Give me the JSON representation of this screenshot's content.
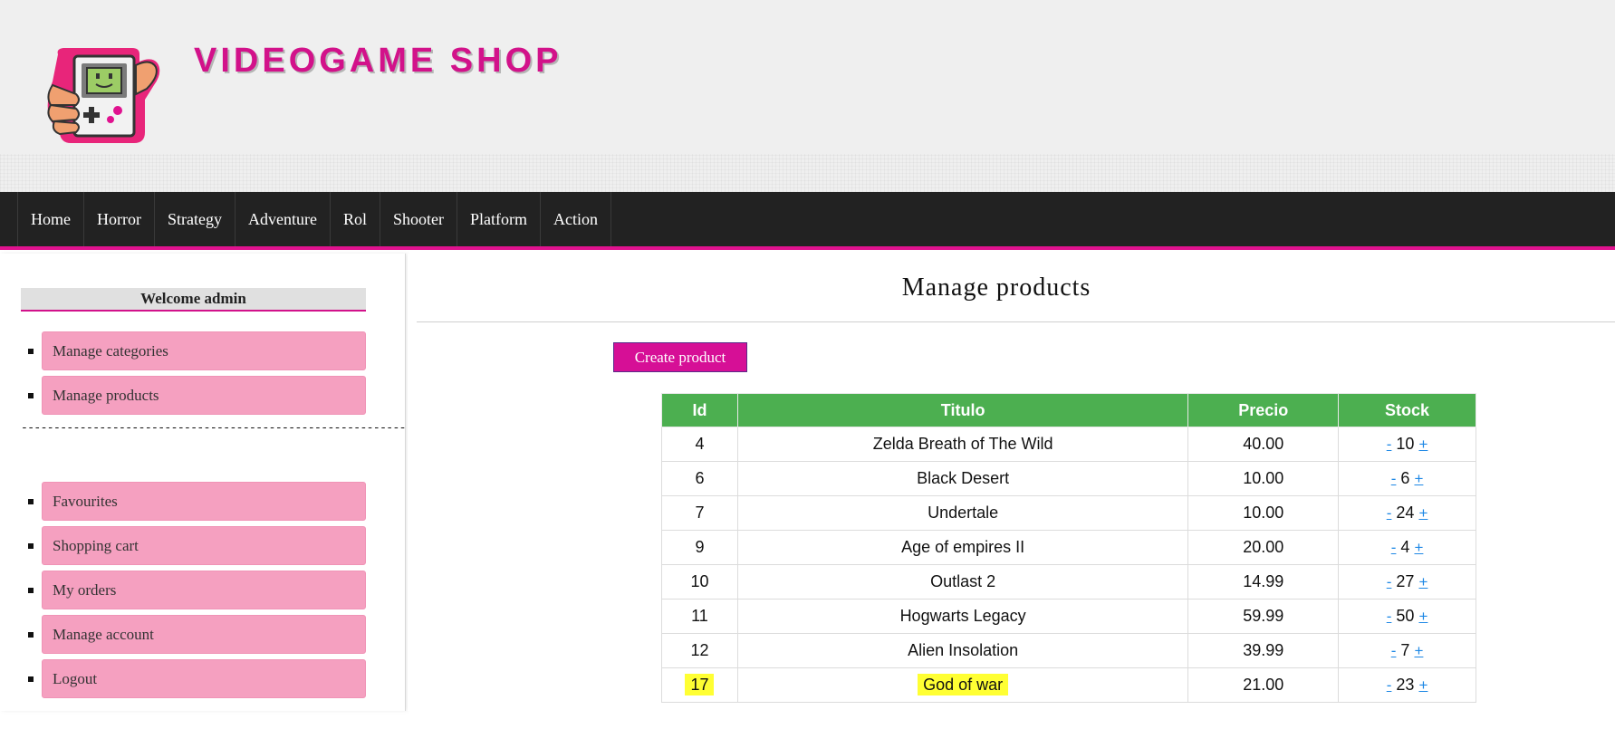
{
  "header": {
    "site_title": "VIDEOGAME SHOP",
    "brand_color": "#d2128a",
    "logo_icon": "gameboy-hand-icon"
  },
  "nav": {
    "items": [
      "Home",
      "Horror",
      "Strategy",
      "Adventure",
      "Rol",
      "Shooter",
      "Platform",
      "Action"
    ]
  },
  "sidebar": {
    "welcome": "Welcome admin",
    "admin_items": [
      "Manage categories",
      "Manage products"
    ],
    "divider": "------------------------------------------------------------",
    "user_items": [
      "Favourites",
      "Shopping cart",
      "My orders",
      "Manage account",
      "Logout"
    ]
  },
  "main": {
    "title": "Manage products",
    "create_button": "Create product",
    "table": {
      "headers": [
        "Id",
        "Titulo",
        "Precio",
        "Stock"
      ],
      "header_color": "#4caf50",
      "decrement_label": "-",
      "increment_label": "+",
      "rows": [
        {
          "id": "4",
          "title": "Zelda Breath of The Wild",
          "price": "40.00",
          "stock": "10"
        },
        {
          "id": "6",
          "title": "Black Desert",
          "price": "10.00",
          "stock": "6"
        },
        {
          "id": "7",
          "title": "Undertale",
          "price": "10.00",
          "stock": "24"
        },
        {
          "id": "9",
          "title": "Age of empires II",
          "price": "20.00",
          "stock": "4"
        },
        {
          "id": "10",
          "title": "Outlast 2",
          "price": "14.99",
          "stock": "27"
        },
        {
          "id": "11",
          "title": "Hogwarts Legacy",
          "price": "59.99",
          "stock": "50"
        },
        {
          "id": "12",
          "title": "Alien Insolation",
          "price": "39.99",
          "stock": "7"
        },
        {
          "id": "17",
          "title": "God of war",
          "price": "21.00",
          "stock": "23",
          "highlighted": true
        }
      ]
    }
  }
}
